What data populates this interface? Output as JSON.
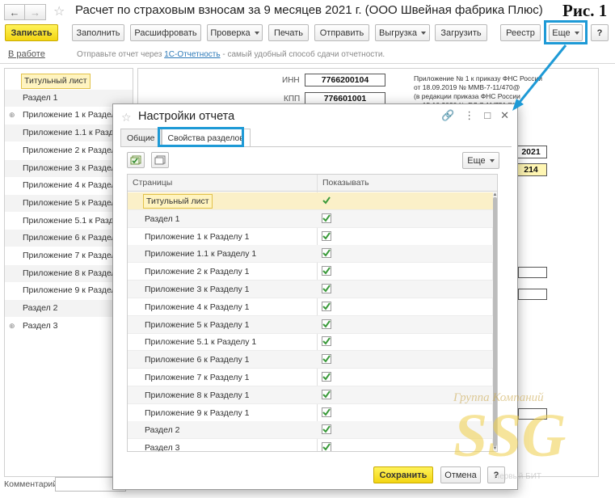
{
  "window": {
    "title": "Расчет по страховым взносам за 9 месяцев 2021 г. (ООО Швейная фабрика Плюс)",
    "figure_label": "Рис. 1"
  },
  "toolbar": {
    "save": "Записать",
    "fill": "Заполнить",
    "decode": "Расшифровать",
    "check": "Проверка",
    "print": "Печать",
    "send": "Отправить",
    "upload": "Выгрузка",
    "load": "Загрузить",
    "registry": "Реестр",
    "more": "Еще",
    "help": "?"
  },
  "status": {
    "state": "В работе",
    "hint_before": "Отправьте отчет через ",
    "hint_link": "1С-Отчетность",
    "hint_after": " - самый удобный способ сдачи отчетности."
  },
  "pages": [
    {
      "label": "Титульный лист",
      "selected": true,
      "bullet": ""
    },
    {
      "label": "Раздел 1",
      "bullet": ""
    },
    {
      "label": "Приложение 1 к Разделу 1",
      "bullet": "⊕"
    },
    {
      "label": "Приложение 1.1 к Разделу 1",
      "bullet": ""
    },
    {
      "label": "Приложение 2 к Разделу 1",
      "bullet": ""
    },
    {
      "label": "Приложение 3 к Разделу 1",
      "bullet": ""
    },
    {
      "label": "Приложение 4 к Разделу 1",
      "bullet": ""
    },
    {
      "label": "Приложение 5 к Разделу 1",
      "bullet": ""
    },
    {
      "label": "Приложение 5.1 к Разделу 1",
      "bullet": ""
    },
    {
      "label": "Приложение 6 к Разделу 1",
      "bullet": ""
    },
    {
      "label": "Приложение 7 к Разделу 1",
      "bullet": ""
    },
    {
      "label": "Приложение 8 к Разделу 1",
      "bullet": ""
    },
    {
      "label": "Приложение 9 к Разделу 1",
      "bullet": ""
    },
    {
      "label": "Раздел 2",
      "bullet": ""
    },
    {
      "label": "Раздел 3",
      "bullet": "⊕"
    }
  ],
  "form": {
    "inn_label": "ИНН",
    "inn_value": "7766200104",
    "kpp_label": "КПП",
    "kpp_value": "776601001",
    "note_line1": "Приложение № 1 к приказу ФНС России",
    "note_line2": "от 18.09.2019 № ММВ-7-11/470@",
    "note_line3": "(в редакции приказа ФНС России",
    "note_line4": "от 15.10.2020 № ЕД-7-11/751@)",
    "year_value": "2021",
    "code_value": "214"
  },
  "comment_label": "Комментарий:",
  "dialog": {
    "title": "Настройки отчета",
    "tab_general": "Общие",
    "tab_sections": "Свойства разделов",
    "more": "Еще",
    "col_pages": "Страницы",
    "col_show": "Показывать",
    "rows": [
      {
        "name": "Титульный лист",
        "show": true,
        "selected": true
      },
      {
        "name": "Раздел 1",
        "show": true
      },
      {
        "name": "Приложение 1 к Разделу 1",
        "show": true
      },
      {
        "name": "Приложение 1.1 к Разделу 1",
        "show": true
      },
      {
        "name": "Приложение 2 к Разделу 1",
        "show": true
      },
      {
        "name": "Приложение 3 к Разделу 1",
        "show": true
      },
      {
        "name": "Приложение 4 к Разделу 1",
        "show": true
      },
      {
        "name": "Приложение 5 к Разделу 1",
        "show": true
      },
      {
        "name": "Приложение 5.1 к Разделу 1",
        "show": true
      },
      {
        "name": "Приложение 6 к Разделу 1",
        "show": true
      },
      {
        "name": "Приложение 7 к Разделу 1",
        "show": true
      },
      {
        "name": "Приложение 8 к Разделу 1",
        "show": true
      },
      {
        "name": "Приложение 9 к Разделу 1",
        "show": true
      },
      {
        "name": "Раздел 2",
        "show": true
      },
      {
        "name": "Раздел 3",
        "show": true
      }
    ],
    "save": "Сохранить",
    "cancel": "Отмена",
    "help": "?"
  },
  "watermark": {
    "line1": "Группа Компаний",
    "logo": "SSG",
    "line2": "Первый БИТ"
  },
  "colors": {
    "accent_yellow": "#f3d512",
    "highlight_blue": "#1e9ad6",
    "check_green": "#3a9a3a",
    "selection": "#fbf0c8"
  }
}
